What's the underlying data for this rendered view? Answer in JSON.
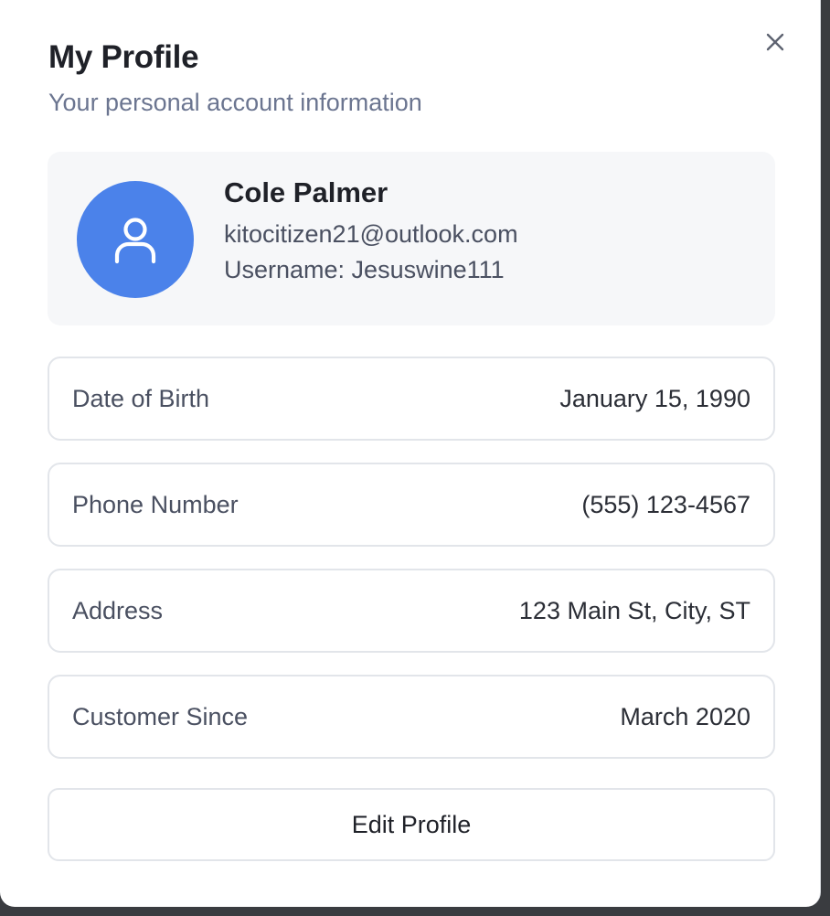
{
  "dialog": {
    "title": "My Profile",
    "subtitle": "Your personal account information",
    "close_icon": "close-icon"
  },
  "profile": {
    "avatar_icon": "user-icon",
    "avatar_color": "#4b82ea",
    "name": "Cole Palmer",
    "email": "kitocitizen21@outlook.com",
    "username": "Username: Jesuswine111"
  },
  "details": [
    {
      "label": "Date of Birth",
      "value": "January 15, 1990"
    },
    {
      "label": "Phone Number",
      "value": "(555) 123-4567"
    },
    {
      "label": "Address",
      "value": "123 Main St, City, ST"
    },
    {
      "label": "Customer Since",
      "value": "March 2020"
    }
  ],
  "actions": {
    "edit_label": "Edit Profile"
  }
}
